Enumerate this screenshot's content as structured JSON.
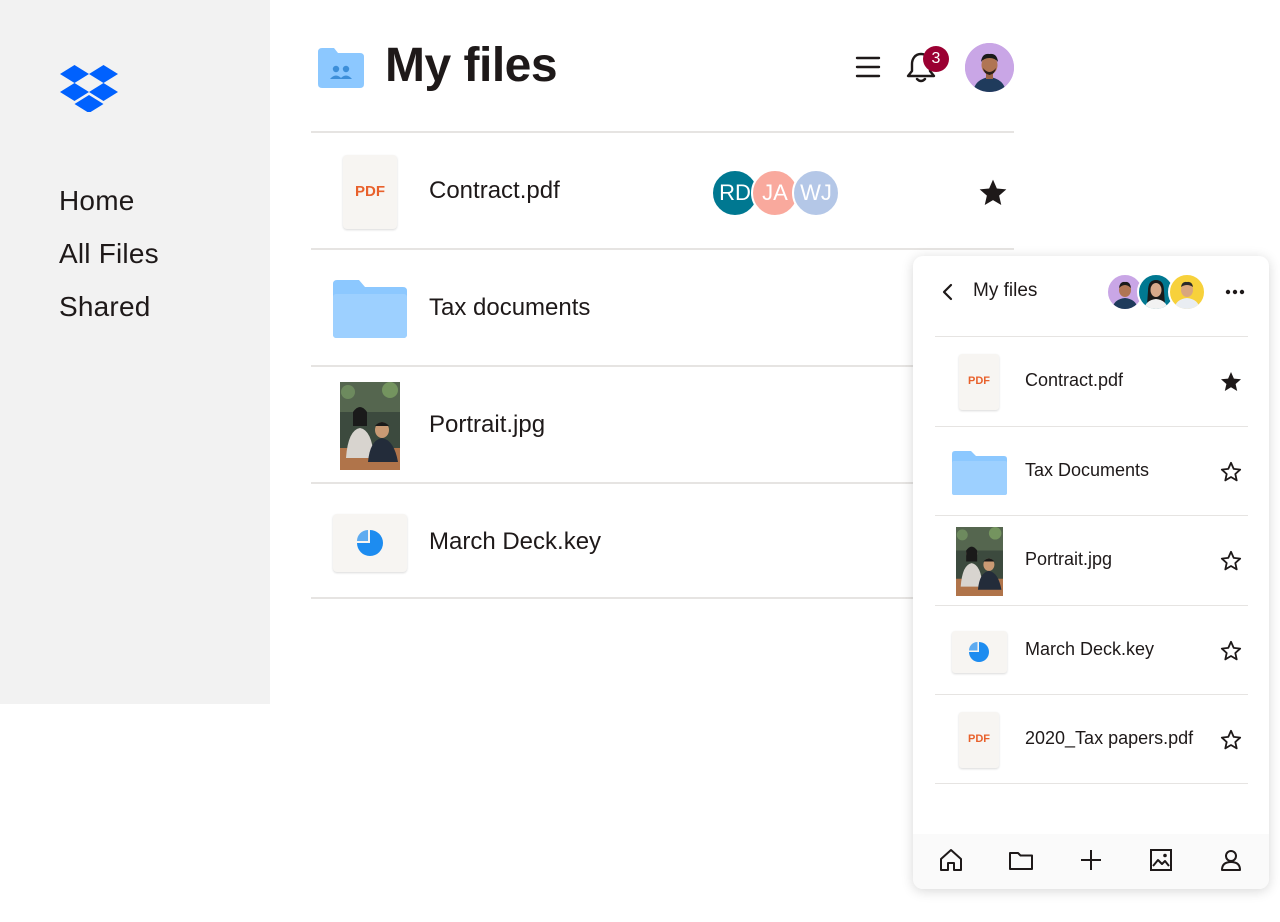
{
  "sidebar": {
    "logo_icon": "dropbox-logo-icon",
    "items": [
      {
        "label": "Home"
      },
      {
        "label": "All Files"
      },
      {
        "label": "Shared"
      }
    ]
  },
  "header": {
    "title": "My files",
    "folder_icon": "shared-folder-icon",
    "menu_icon": "hamburger-menu-icon",
    "bell_icon": "bell-icon",
    "notification_count": "3"
  },
  "files": [
    {
      "name": "Contract.pdf",
      "type": "pdf",
      "thumb_label": "PDF",
      "starred": true,
      "collaborators": [
        {
          "initials": "RD",
          "color": "#007891"
        },
        {
          "initials": "JA",
          "color": "#f9a99d"
        },
        {
          "initials": "WJ",
          "color": "#b4c7e7"
        }
      ]
    },
    {
      "name": "Tax documents",
      "type": "folder"
    },
    {
      "name": "Portrait.jpg",
      "type": "image"
    },
    {
      "name": "March Deck.key",
      "type": "deck"
    }
  ],
  "mobile": {
    "title": "My files",
    "back_icon": "chevron-left-icon",
    "more_icon": "more-horizontal-icon",
    "files": [
      {
        "name": "Contract.pdf",
        "type": "pdf",
        "thumb_label": "PDF",
        "starred": true
      },
      {
        "name": "Tax Documents",
        "type": "folder",
        "starred": false
      },
      {
        "name": "Portrait.jpg",
        "type": "image",
        "starred": false
      },
      {
        "name": "March Deck.key",
        "type": "deck",
        "starred": false
      },
      {
        "name": "2020_Tax papers.pdf",
        "type": "pdf",
        "thumb_label": "PDF",
        "starred": false
      }
    ],
    "bottom_tabs": [
      "home-icon",
      "folder-icon",
      "plus-icon",
      "photos-icon",
      "account-icon"
    ]
  },
  "colors": {
    "dropbox_blue": "#0061fe",
    "folder_blue": "#8cc8ff",
    "pdf_orange": "#e8612c",
    "badge_red": "#9b0032",
    "sidebar_bg": "#f2f2f2"
  }
}
